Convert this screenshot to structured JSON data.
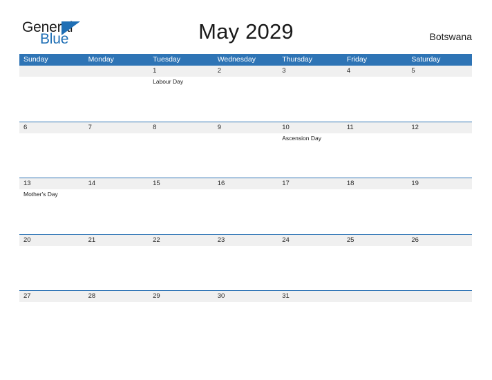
{
  "brand": {
    "name_part1": "General",
    "name_part2": "Blue",
    "accent_color": "#1f6fb5"
  },
  "header": {
    "title": "May 2029",
    "country": "Botswana"
  },
  "calendar": {
    "header_bg": "#2e74b5",
    "date_band_bg": "#f0f0f0",
    "weekday_labels": [
      "Sunday",
      "Monday",
      "Tuesday",
      "Wednesday",
      "Thursday",
      "Friday",
      "Saturday"
    ],
    "weeks": [
      [
        {
          "date": "",
          "events": []
        },
        {
          "date": "",
          "events": []
        },
        {
          "date": "1",
          "events": [
            "Labour Day"
          ]
        },
        {
          "date": "2",
          "events": []
        },
        {
          "date": "3",
          "events": []
        },
        {
          "date": "4",
          "events": []
        },
        {
          "date": "5",
          "events": []
        }
      ],
      [
        {
          "date": "6",
          "events": []
        },
        {
          "date": "7",
          "events": []
        },
        {
          "date": "8",
          "events": []
        },
        {
          "date": "9",
          "events": []
        },
        {
          "date": "10",
          "events": [
            "Ascension Day"
          ]
        },
        {
          "date": "11",
          "events": []
        },
        {
          "date": "12",
          "events": []
        }
      ],
      [
        {
          "date": "13",
          "events": [
            "Mother's Day"
          ]
        },
        {
          "date": "14",
          "events": []
        },
        {
          "date": "15",
          "events": []
        },
        {
          "date": "16",
          "events": []
        },
        {
          "date": "17",
          "events": []
        },
        {
          "date": "18",
          "events": []
        },
        {
          "date": "19",
          "events": []
        }
      ],
      [
        {
          "date": "20",
          "events": []
        },
        {
          "date": "21",
          "events": []
        },
        {
          "date": "22",
          "events": []
        },
        {
          "date": "23",
          "events": []
        },
        {
          "date": "24",
          "events": []
        },
        {
          "date": "25",
          "events": []
        },
        {
          "date": "26",
          "events": []
        }
      ],
      [
        {
          "date": "27",
          "events": []
        },
        {
          "date": "28",
          "events": []
        },
        {
          "date": "29",
          "events": []
        },
        {
          "date": "30",
          "events": []
        },
        {
          "date": "31",
          "events": []
        },
        {
          "date": "",
          "events": []
        },
        {
          "date": "",
          "events": []
        }
      ]
    ]
  }
}
